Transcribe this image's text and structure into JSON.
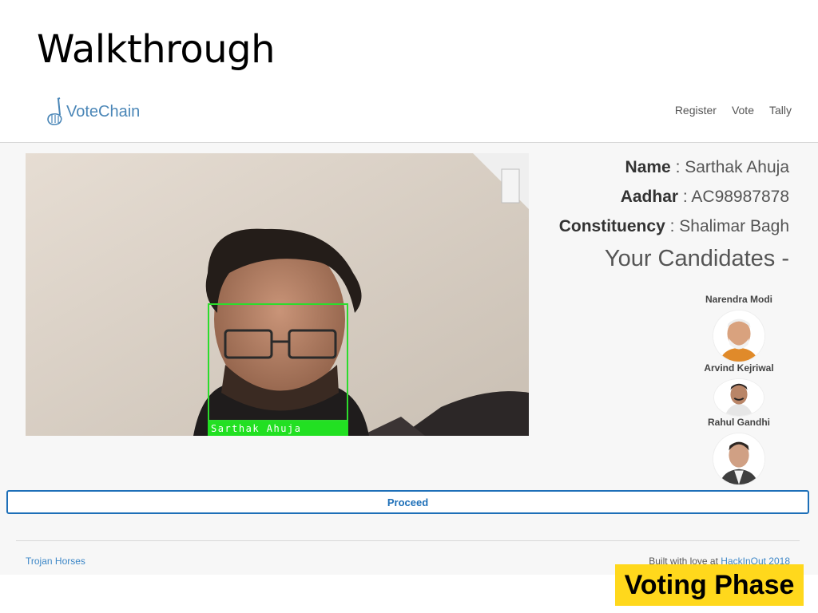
{
  "slide": {
    "title": "Walkthrough",
    "phase_badge": "Voting Phase"
  },
  "navbar": {
    "brand": "VoteChain",
    "links": [
      "Register",
      "Vote",
      "Tally"
    ]
  },
  "webcam": {
    "face_label": "Sarthak Ahuja",
    "box_color": "#2cdc2c"
  },
  "voter": {
    "name_label": "Name",
    "name_value": " : Sarthak Ahuja",
    "aadhar_label": "Aadhar",
    "aadhar_value": " : AC98987878",
    "constituency_label": "Constituency",
    "constituency_value": " : Shalimar Bagh"
  },
  "candidates": {
    "heading": "Your Candidates -",
    "items": [
      {
        "name": "Narendra Modi"
      },
      {
        "name": "Arvind Kejriwal"
      },
      {
        "name": "Rahul Gandhi"
      }
    ]
  },
  "actions": {
    "proceed_label": "Proceed"
  },
  "footer": {
    "left_text": "Trojan Horses",
    "right_prefix": "Built with love at ",
    "right_link": "HackInOut 2018"
  },
  "colors": {
    "accent": "#1d6fb8",
    "link": "#3d87c7",
    "badge": "#ffd81c"
  }
}
